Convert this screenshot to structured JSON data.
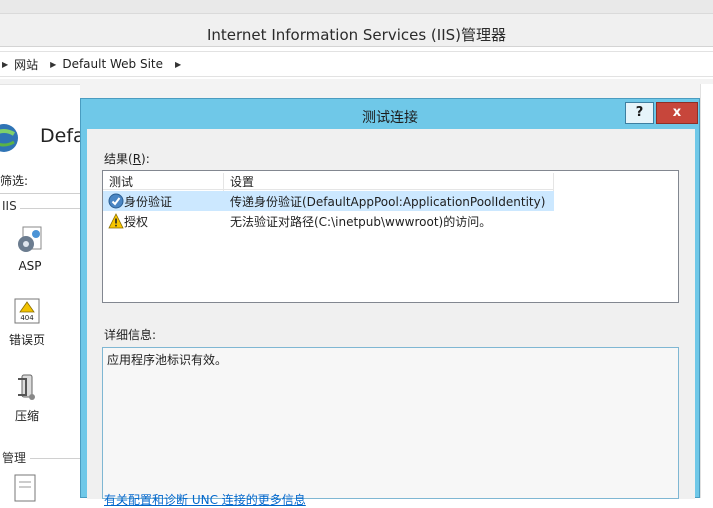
{
  "window": {
    "title": "Internet Information Services (IIS)管理器"
  },
  "address_bar": {
    "crumbs": [
      "网站",
      "Default Web Site"
    ]
  },
  "main": {
    "site_name": "Defa",
    "filter_label": "筛选:",
    "group_iis": "IIS",
    "features": [
      {
        "label": "ASP",
        "icon": "asp-gear-icon"
      },
      {
        "label": "错误页",
        "icon": "error-page-404-icon"
      },
      {
        "label": "压缩",
        "icon": "compression-clamp-icon"
      }
    ],
    "group_management": "管理"
  },
  "dialog": {
    "title": "测试连接",
    "help_button": "?",
    "close_button": "x",
    "results_label_prefix": "结果(",
    "results_label_key": "R",
    "results_label_suffix": "):",
    "columns": {
      "test": "测试",
      "setting": "设置"
    },
    "rows": [
      {
        "test": "身份验证",
        "setting": "传递身份验证(DefaultAppPool:ApplicationPoolIdentity)",
        "status": "success",
        "selected": true
      },
      {
        "test": "授权",
        "setting": "无法验证对路径(C:\\inetpub\\wwwroot)的访问。",
        "status": "warning",
        "selected": false
      }
    ],
    "details_label": "详细信息:",
    "details_text": "应用程序池标识有效。",
    "more_info_link": "有关配置和诊断 UNC 连接的更多信息"
  },
  "colors": {
    "dialog_frame": "#6fc8e8",
    "close_button": "#c7463b",
    "selected_row": "#cce8ff",
    "link": "#0066cc"
  }
}
